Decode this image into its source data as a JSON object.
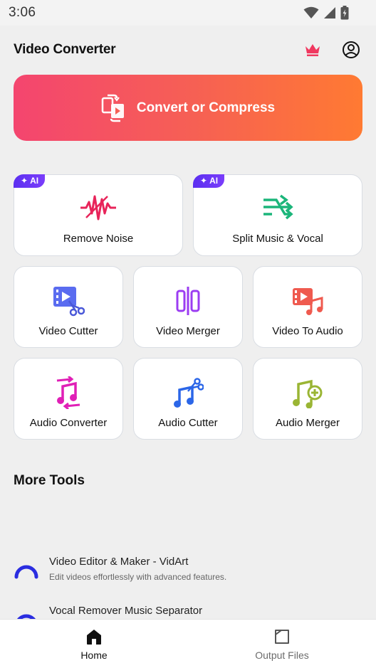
{
  "status_bar": {
    "time": "3:06"
  },
  "header": {
    "title": "Video Converter"
  },
  "convert": {
    "label": "Convert or Compress"
  },
  "ai_badge": "AI",
  "tools_large": [
    {
      "label": "Remove Noise",
      "icon": "noise-wave-icon",
      "ai": true
    },
    {
      "label": "Split Music & Vocal",
      "icon": "split-arrows-icon",
      "ai": true
    }
  ],
  "tools_small": [
    {
      "label": "Video Cutter",
      "icon": "video-cutter-icon"
    },
    {
      "label": "Video Merger",
      "icon": "video-merger-icon"
    },
    {
      "label": "Video To Audio",
      "icon": "video-to-audio-icon"
    },
    {
      "label": "Audio Converter",
      "icon": "audio-converter-icon"
    },
    {
      "label": "Audio Cutter",
      "icon": "audio-cutter-icon"
    },
    {
      "label": "Audio Merger",
      "icon": "audio-merger-icon"
    }
  ],
  "more_tools": {
    "title": "More Tools",
    "items": [
      {
        "title": "Video Editor & Maker - VidArt",
        "desc": "Edit videos effortlessly with advanced features."
      },
      {
        "title": "Vocal Remover Music Separator",
        "desc": ""
      }
    ]
  },
  "bottom_nav": [
    {
      "label": "Home",
      "icon": "home-icon",
      "active": true
    },
    {
      "label": "Output Files",
      "icon": "folder-icon",
      "active": false
    }
  ],
  "colors": {
    "gradient_start": "#f4456f",
    "gradient_end": "#ff7a32",
    "crown": "#f0385f",
    "ai_badge": "#5b2ff0"
  }
}
